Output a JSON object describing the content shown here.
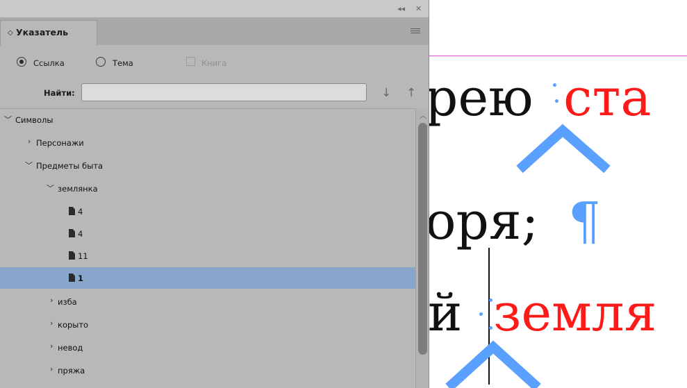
{
  "panel": {
    "title": "Указатель",
    "tab_arrow": "◇",
    "collapse_glyph": "◂◂",
    "close_glyph": "✕",
    "mode": {
      "reference_label": "Ссылка",
      "topic_label": "Тема",
      "book_label": "Книга",
      "selected": "reference"
    },
    "find": {
      "label": "Найти:",
      "value": "",
      "next_glyph": "↓",
      "prev_glyph": "↑"
    },
    "tree": [
      {
        "label": "Символы",
        "level": 0,
        "expanded": true
      },
      {
        "label": "Персонажи",
        "level": 1,
        "expanded": false
      },
      {
        "label": "Предметы быта",
        "level": 1,
        "expanded": true
      },
      {
        "label": "землянка",
        "level": 2,
        "expanded": true
      },
      {
        "label": "4",
        "level": 3,
        "page": true
      },
      {
        "label": "4",
        "level": 3,
        "page": true
      },
      {
        "label": "11",
        "level": 3,
        "page": true
      },
      {
        "label": "1",
        "level": 3,
        "page": true,
        "selected": true
      },
      {
        "label": "изба",
        "level": 2,
        "expanded": false
      },
      {
        "label": "корыто",
        "level": 2,
        "expanded": false
      },
      {
        "label": "невод",
        "level": 2,
        "expanded": false
      },
      {
        "label": "пряжа",
        "level": 2,
        "expanded": false
      }
    ]
  },
  "document": {
    "line1_black": "рею",
    "line1_red": "ста",
    "line2_black": "оря;",
    "line2_pilcrow": "¶",
    "line3_black": "й",
    "line3_red": "земля"
  },
  "colors": {
    "panel_bg": "#b8b8b8",
    "selection": "#88a6cb",
    "accent_red": "#ff1a1a",
    "marker_blue": "#5aa0ff"
  }
}
